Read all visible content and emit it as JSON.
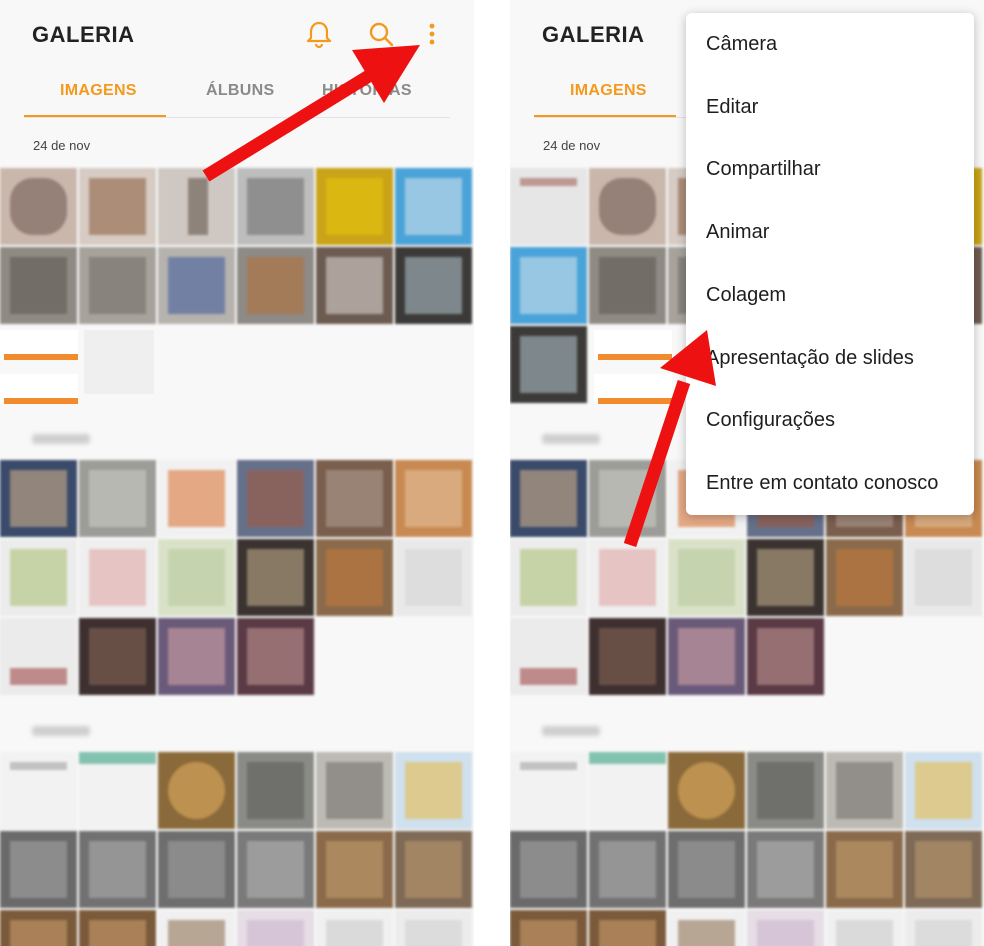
{
  "app": {
    "title": "GALERIA"
  },
  "header_icons": [
    "bell-icon",
    "search-icon",
    "more-vert-icon"
  ],
  "tabs": [
    {
      "label": "IMAGENS",
      "active": true
    },
    {
      "label": "ÁLBUNS",
      "active": false
    },
    {
      "label": "HISTÓRIAS",
      "active": false
    }
  ],
  "sections": [
    {
      "date": "24 de nov"
    }
  ],
  "menu": {
    "items": [
      {
        "label": "Câmera"
      },
      {
        "label": "Editar"
      },
      {
        "label": "Compartilhar"
      },
      {
        "label": "Animar"
      },
      {
        "label": "Colagem"
      },
      {
        "label": "Apresentação de slides"
      },
      {
        "label": "Configurações"
      },
      {
        "label": "Entre em contato conosco"
      }
    ]
  },
  "colors": {
    "accent": "#f39a1e",
    "annotation_arrow": "#ee1111",
    "background": "#f8f8f8"
  }
}
